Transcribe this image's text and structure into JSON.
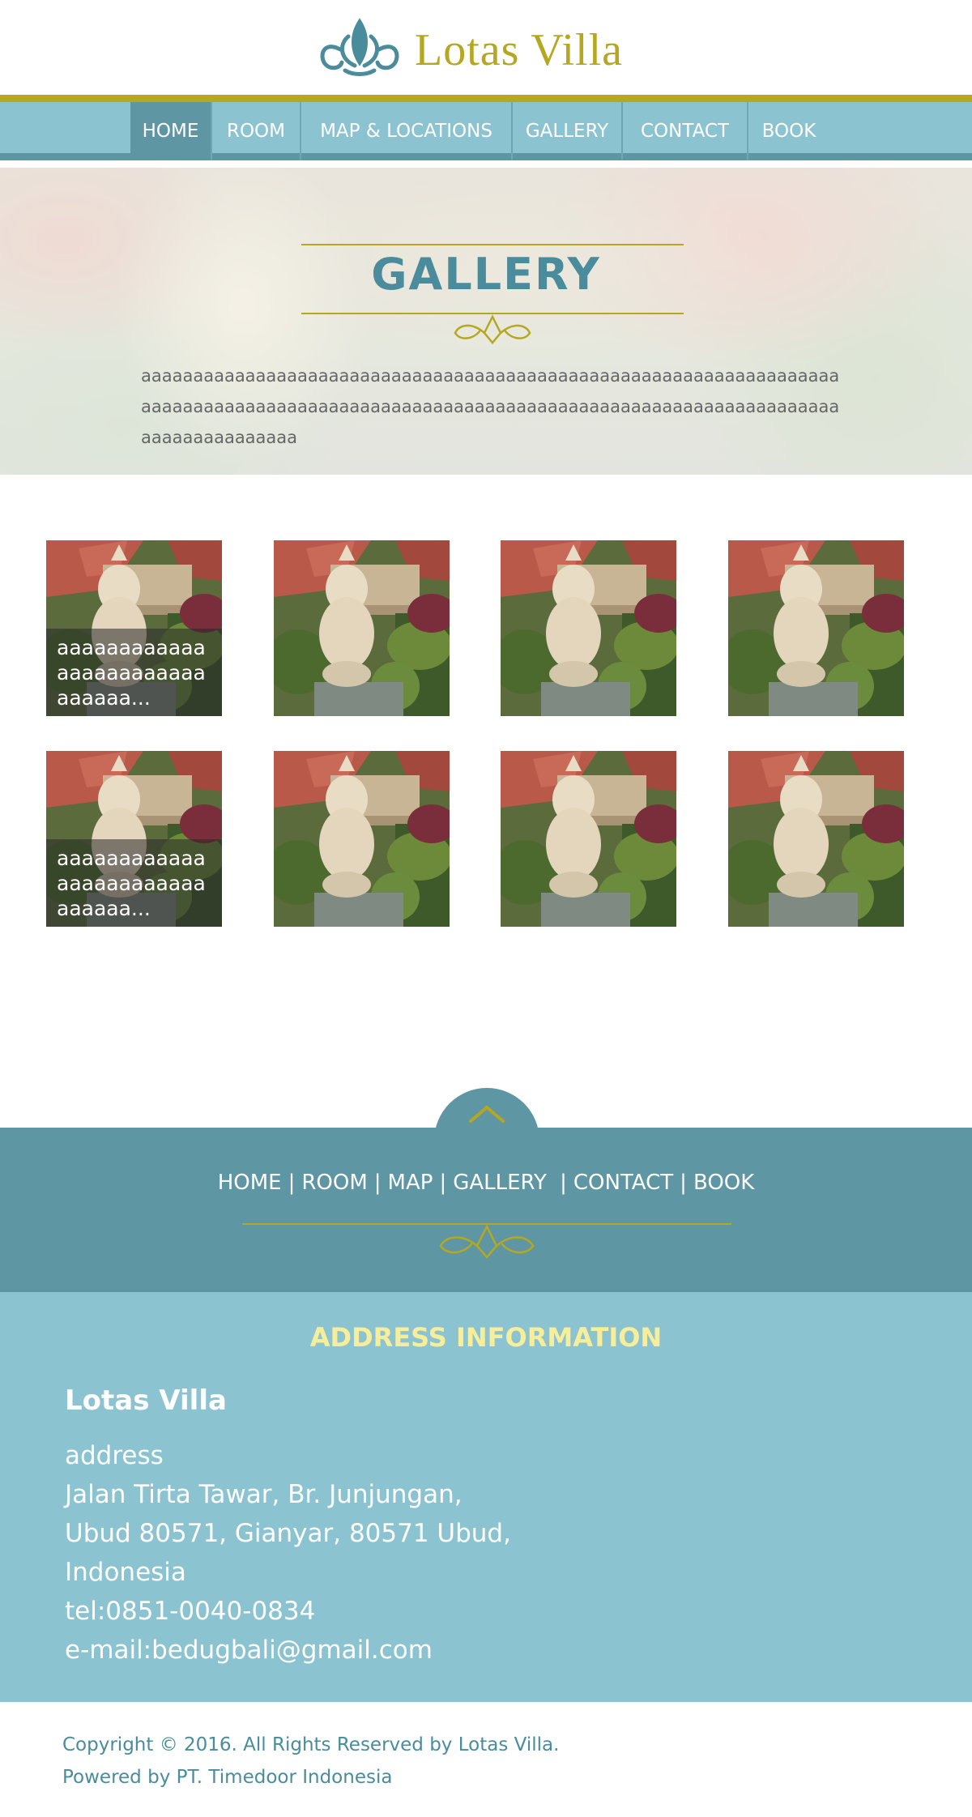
{
  "brand": {
    "name": "Lotas Villa",
    "logo_icon": "lotus-icon",
    "colors": {
      "gold": "#b5a820",
      "teal_dark": "#5f96a3",
      "teal_light": "#8cc3d1",
      "title_teal": "#4a8c9c"
    }
  },
  "nav": {
    "items": [
      {
        "label": "HOME",
        "active": true
      },
      {
        "label": "ROOM",
        "active": false
      },
      {
        "label": "MAP &  LOCATIONS",
        "active": false
      },
      {
        "label": "GALLERY",
        "active": false
      },
      {
        "label": "CONTACT",
        "active": false
      },
      {
        "label": "BOOK",
        "active": false
      }
    ]
  },
  "hero": {
    "title": "GALLERY",
    "ornament_icon": "flourish-ornament-icon",
    "text": "aaaaaaaaaaaaaaaaaaaaaaaaaaaaaaaaaaaaaaaaaaaaaaaaaaaaaaaaaaaaaaaaaaaaaaaaaaaaaaaaaaaaaaaaaaaaaaaaaaaaaaaaaaaaaaaaaaaaaaaaaaaaaaaaaaaaaaaaaaaaaaaaaaaaa"
  },
  "gallery": {
    "rows": [
      {
        "items": [
          {
            "caption": "aaaaaaaaaaaaaaaaaaaaaaaaaaaaaa..."
          },
          {
            "caption": ""
          },
          {
            "caption": ""
          },
          {
            "caption": ""
          }
        ]
      },
      {
        "items": [
          {
            "caption": "aaaaaaaaaaaaaaaaaaaaaaaaaaaaaa..."
          },
          {
            "caption": ""
          },
          {
            "caption": ""
          },
          {
            "caption": ""
          }
        ]
      }
    ]
  },
  "back_to_top_icon": "chevron-up-icon",
  "footer_nav": {
    "links": [
      {
        "label": "HOME"
      },
      {
        "label": "ROOM"
      },
      {
        "label": "MAP"
      },
      {
        "label": "GALLERY "
      },
      {
        "label": "CONTACT"
      },
      {
        "label": "BOOK"
      }
    ],
    "separator": "|"
  },
  "address": {
    "heading": "ADDRESS INFORMATION",
    "name": "Lotas Villa",
    "lines": [
      "address",
      "Jalan Tirta Tawar, Br. Junjungan,",
      "Ubud 80571, Gianyar, 80571 Ubud,",
      "Indonesia",
      "tel:0851-0040-0834",
      "e-mail:bedugbali@gmail.com"
    ]
  },
  "copyright": {
    "line1": "Copyright © 2016. All Rights Reserved by Lotas Villa.",
    "line2": "Powered by PT. Timedoor Indonesia"
  }
}
